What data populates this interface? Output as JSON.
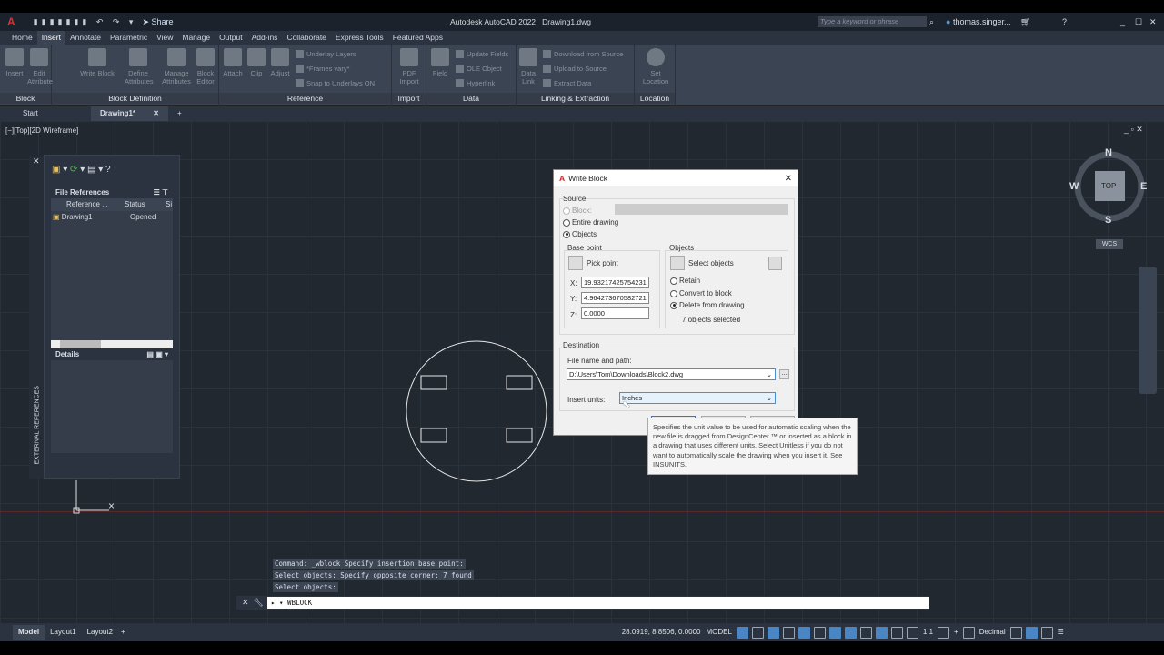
{
  "titlebar": {
    "title": "Autodesk AutoCAD 2022",
    "document": "Drawing1.dwg",
    "share": "Share",
    "search_placeholder": "Type a keyword or phrase",
    "user": "thomas.singer..."
  },
  "menu": [
    "Home",
    "Insert",
    "Annotate",
    "Parametric",
    "View",
    "Manage",
    "Output",
    "Add-ins",
    "Collaborate",
    "Express Tools",
    "Featured Apps"
  ],
  "ribbon": {
    "block": {
      "label": "Block",
      "tools": [
        "Insert",
        "Edit Attribute"
      ]
    },
    "block_definition": {
      "label": "Block Definition",
      "tools": [
        "Write Block",
        "Define Attributes",
        "Manage Attributes",
        "Block Editor"
      ]
    },
    "reference": {
      "label": "Reference",
      "tools": [
        "Attach",
        "Clip",
        "Adjust"
      ],
      "small": [
        "Underlay Layers",
        "*Frames vary*",
        "Snap to Underlays ON"
      ]
    },
    "import": {
      "label": "Import",
      "tools": [
        "PDF Import"
      ]
    },
    "data": {
      "label": "Data",
      "tools": [
        "Field"
      ],
      "small": [
        "Update Fields",
        "OLE Object",
        "Hyperlink"
      ]
    },
    "linking": {
      "label": "Linking & Extraction",
      "tools": [
        "Data Link"
      ],
      "small": [
        "Download from Source",
        "Upload to Source",
        "Extract Data"
      ]
    },
    "location": {
      "label": "Location",
      "tools": [
        "Set Location"
      ]
    }
  },
  "doctabs": [
    "Start",
    "Drawing1*"
  ],
  "viewport_label": "[−][Top][2D Wireframe]",
  "viewcube": {
    "n": "N",
    "s": "S",
    "e": "E",
    "w": "W",
    "face": "TOP",
    "wcs": "WCS"
  },
  "xref": {
    "side_title": "EXTERNAL REFERENCES",
    "section": "File References",
    "columns": [
      "Reference ...",
      "Status",
      "Si"
    ],
    "rows": [
      {
        "name": "Drawing1",
        "status": "Opened"
      }
    ],
    "details": "Details"
  },
  "dialog": {
    "title": "Write Block",
    "source": "Source",
    "block": "Block:",
    "entire": "Entire drawing",
    "objects": "Objects",
    "base_point": "Base point",
    "pick_point": "Pick point",
    "x_label": "X:",
    "y_label": "Y:",
    "z_label": "Z:",
    "x": "19.93217425754231",
    "y": "4.964273670582721",
    "z": "0.0000",
    "objects_group": "Objects",
    "select_objects": "Select objects",
    "retain": "Retain",
    "convert": "Convert to block",
    "delete": "Delete from drawing",
    "selected": "7 objects selected",
    "destination": "Destination",
    "file_label": "File name and path:",
    "file": "D:\\Users\\Tom\\Downloads\\Block2.dwg",
    "browse": "...",
    "units_label": "Insert units:",
    "units": "Inches"
  },
  "tooltip": "Specifies the unit value to be used for automatic scaling when the new file is dragged from DesignCenter ™ or inserted as a block in a drawing that uses different units. Select Unitless if you do not want to automatically scale the drawing when you insert it. See INSUNITS.",
  "command": {
    "history": [
      "Command: _wblock Specify insertion base point:",
      "Select objects: Specify opposite corner: 7 found",
      "Select objects:"
    ],
    "input": "WBLOCK"
  },
  "layouts": [
    "Model",
    "Layout1",
    "Layout2"
  ],
  "status": {
    "coords": "28.0919, 8.8506, 0.0000",
    "model": "MODEL",
    "scale": "1:1",
    "units": "Decimal"
  }
}
